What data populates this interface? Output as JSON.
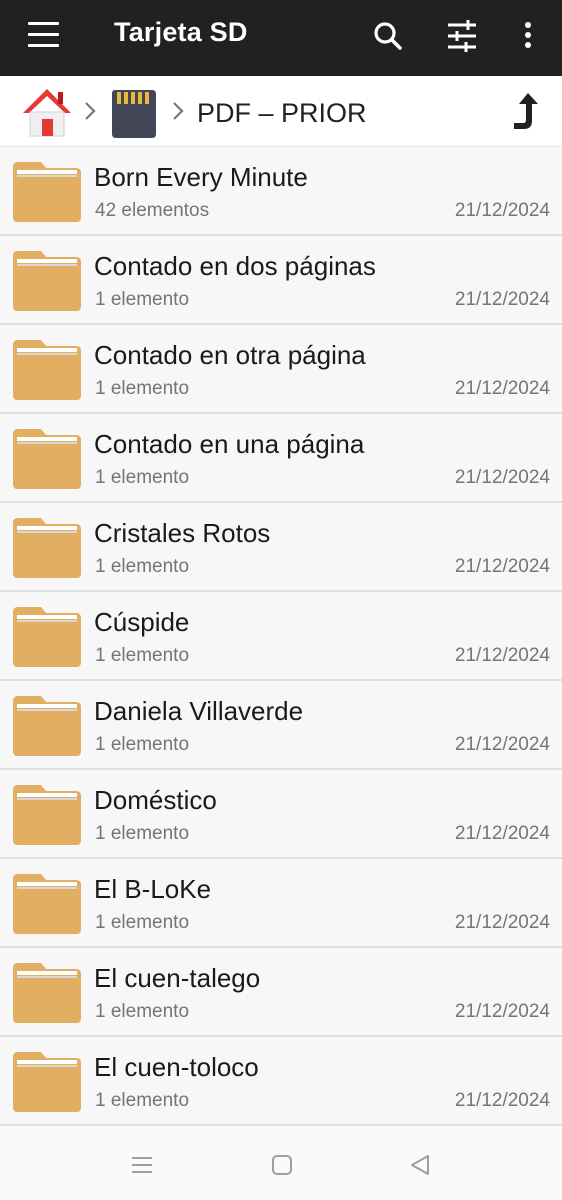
{
  "appbar": {
    "title": "Tarjeta SD",
    "background": "#212121"
  },
  "breadcrumb": {
    "current": "PDF – PRIOR"
  },
  "folder_color": "#e2ae62",
  "items": [
    {
      "name": "Born Every Minute",
      "count": "42 elementos",
      "date": "21/12/2024"
    },
    {
      "name": "Contado en dos páginas",
      "count": "1 elemento",
      "date": "21/12/2024"
    },
    {
      "name": "Contado en otra página",
      "count": "1 elemento",
      "date": "21/12/2024"
    },
    {
      "name": "Contado en una página",
      "count": "1 elemento",
      "date": "21/12/2024"
    },
    {
      "name": "Cristales Rotos",
      "count": "1 elemento",
      "date": "21/12/2024"
    },
    {
      "name": "Cúspide",
      "count": "1 elemento",
      "date": "21/12/2024"
    },
    {
      "name": "Daniela Villaverde",
      "count": "1 elemento",
      "date": "21/12/2024"
    },
    {
      "name": "Doméstico",
      "count": "1 elemento",
      "date": "21/12/2024"
    },
    {
      "name": "El B-LoKe",
      "count": "1 elemento",
      "date": "21/12/2024"
    },
    {
      "name": "El cuen-talego",
      "count": "1 elemento",
      "date": "21/12/2024"
    },
    {
      "name": "El cuen-toloco",
      "count": "1 elemento",
      "date": "21/12/2024"
    }
  ],
  "icons": {
    "menu": "hamburger-menu-icon",
    "search": "search-icon",
    "filter": "sliders-icon",
    "more": "more-vertical-icon",
    "home": "home-icon",
    "sd": "sd-card-icon",
    "up": "up-arrow-icon",
    "folder": "folder-icon"
  }
}
